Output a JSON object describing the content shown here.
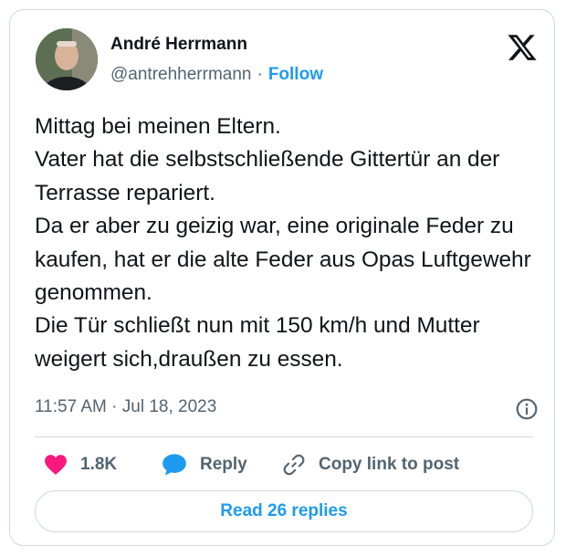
{
  "author": {
    "name": "André Herrmann",
    "handle": "@antrehherrmann",
    "separator": "·",
    "follow_label": "Follow"
  },
  "tweet": {
    "text": "Mittag bei meinen Eltern.\nVater hat die selbstschließende Gittertür an der Terrasse repariert.\nDa er aber zu geizig war, eine originale Feder zu kaufen, hat er die alte Feder aus Opas Luftgewehr genommen.\nDie Tür schließt nun mit 150 km/h und Mutter weigert sich,draußen zu essen.",
    "timestamp": "11:57 AM · Jul 18, 2023"
  },
  "actions": {
    "likes_count": "1.8K",
    "reply_label": "Reply",
    "copy_label": "Copy link to post",
    "read_replies_label": "Read 26 replies"
  },
  "icons": {
    "like": "heart-icon",
    "reply": "speech-bubble-icon",
    "copy": "link-icon",
    "brand": "x-logo-icon",
    "info": "info-icon"
  },
  "colors": {
    "accent": "#1d9bf0",
    "like": "#f91880",
    "secondary_text": "#536471",
    "border": "#cfd9de"
  }
}
